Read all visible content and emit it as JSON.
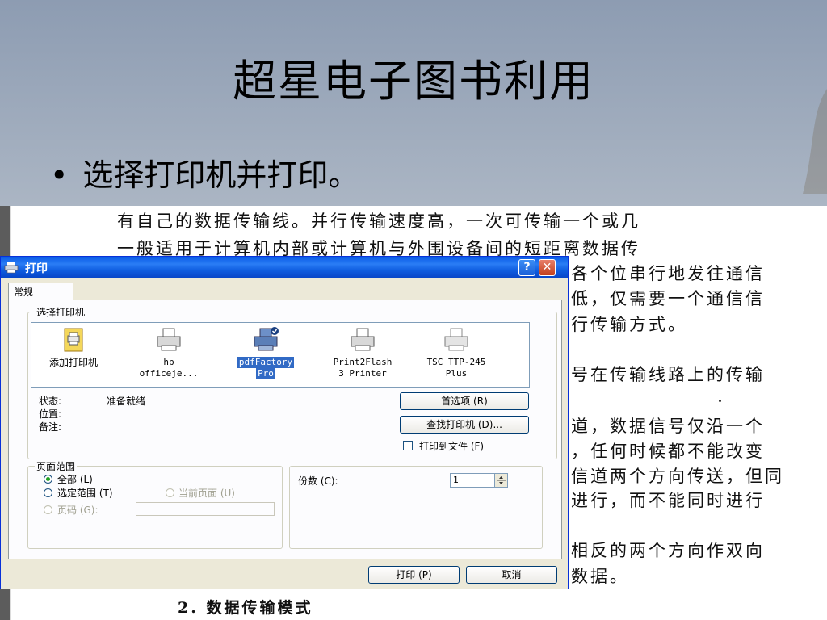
{
  "slide": {
    "title": "超星电子图书利用",
    "bullet_marker": "•",
    "bullet": "选择打印机并打印。"
  },
  "document": {
    "lines": [
      "有自己的数据传输线。并行传输速度高，一次可传输一个或几",
      "一般适用于计算机内部或计算机与外围设备间的短距离数据传",
      "各个位串行地发往通信",
      "低，仅需要一个通信信",
      "行传输方式。",
      "号在传输线路上的传输",
      "道，数据信号仅沿一个",
      "，任何时候都不能改变",
      "信道两个方向传送，但同",
      "进行，而不能同时进行",
      "相反的两个方向作双向",
      "数据。",
      "2. 数据传输模式"
    ]
  },
  "dialog": {
    "title": "打印",
    "help_label": "?",
    "close_label": "✕",
    "tab_general": "常规",
    "group_select_printer": "选择打印机",
    "printers": [
      {
        "name": "添加打印机",
        "line2": "",
        "selected": false,
        "icon": "add-printer-icon"
      },
      {
        "name": "hp",
        "line2": "officeje...",
        "selected": false,
        "icon": "printer-icon"
      },
      {
        "name": "pdfFactory",
        "line2": "Pro",
        "selected": true,
        "icon": "printer-default-icon"
      },
      {
        "name": "Print2Flash",
        "line2": "3 Printer",
        "selected": false,
        "icon": "printer-icon"
      },
      {
        "name": "TSC TTP-245",
        "line2": "Plus",
        "selected": false,
        "icon": "printer-icon"
      }
    ],
    "status_label": "状态:",
    "status_value": "准备就绪",
    "location_label": "位置:",
    "comment_label": "备注:",
    "preferences_button": "首选项 (R)",
    "find_printer_button": "查找打印机 (D)...",
    "print_to_file_label": "打印到文件 (F)",
    "group_page_range": "页面范围",
    "range_all": "全部 (L)",
    "range_selection": "选定范围 (T)",
    "range_current": "当前页面 (U)",
    "range_pages": "页码 (G):",
    "copies_label": "份数 (C):",
    "copies_value": "1",
    "print_button": "打印 (P)",
    "cancel_button": "取消"
  }
}
